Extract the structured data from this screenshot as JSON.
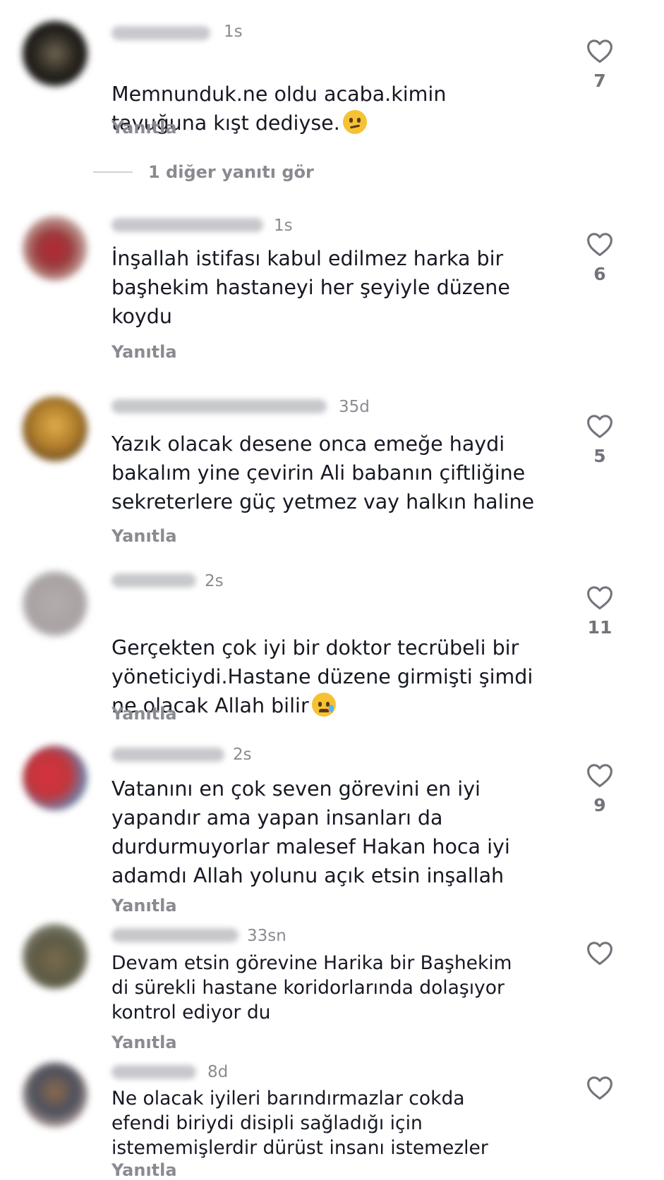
{
  "comments": [
    {
      "time": "1s",
      "text": "Memnunduk.ne oldu acaba.kimin\ntavuğuna kışt dediyse.",
      "emoji": "thinking-face",
      "likes": "7",
      "reply": "Yanıtla"
    },
    {
      "time": "1s",
      "text": "İnşallah istifası kabul edilmez  harka bir\nbaşhekim hastaneyi her şeyiyle düzene\nkoydu",
      "likes": "6",
      "reply": "Yanıtla"
    },
    {
      "time": "35d",
      "text": "Yazık olacak desene onca emeğe haydi\nbakalım yine çevirin Ali babanın çiftliğine\nsekreterlere güç yetmez vay halkın haline",
      "likes": "5",
      "reply": "Yanıtla"
    },
    {
      "time": "2s",
      "text": "Gerçekten çok iyi bir doktor tecrübeli bir\nyöneticiydi.Hastane düzene girmişti şimdi\nne olacak Allah bilir",
      "emoji": "crying-face",
      "likes": "11",
      "reply": "Yanıtla"
    },
    {
      "time": "2s",
      "text": "Vatanını en çok seven görevini en iyi\nyapandır ama yapan insanları da\ndurdurmuyorlar malesef Hakan hoca  iyi\nadamdı Allah yolunu açık etsin inşallah",
      "likes": "9",
      "reply": "Yanıtla"
    },
    {
      "time": "33sn",
      "text": "Devam etsin görevine Harika bir Başhekim\ndi sürekli hastane koridorlarında dolaşıyor\nkontrol ediyor du",
      "likes": "",
      "reply": "Yanıtla"
    },
    {
      "time": "8d",
      "text": "Ne olacak iyileri barındırmazlar  cokda\nefendi  biriydi disipli sağladığı için\nistememişlerdir dürüst insanı  istemezler",
      "likes": "",
      "reply": "Yanıtla"
    }
  ],
  "more_replies": "1 diğer yanıtı gör",
  "colors": {
    "text": "#161823",
    "muted": "#8a8b91",
    "heart": "#73747b"
  }
}
